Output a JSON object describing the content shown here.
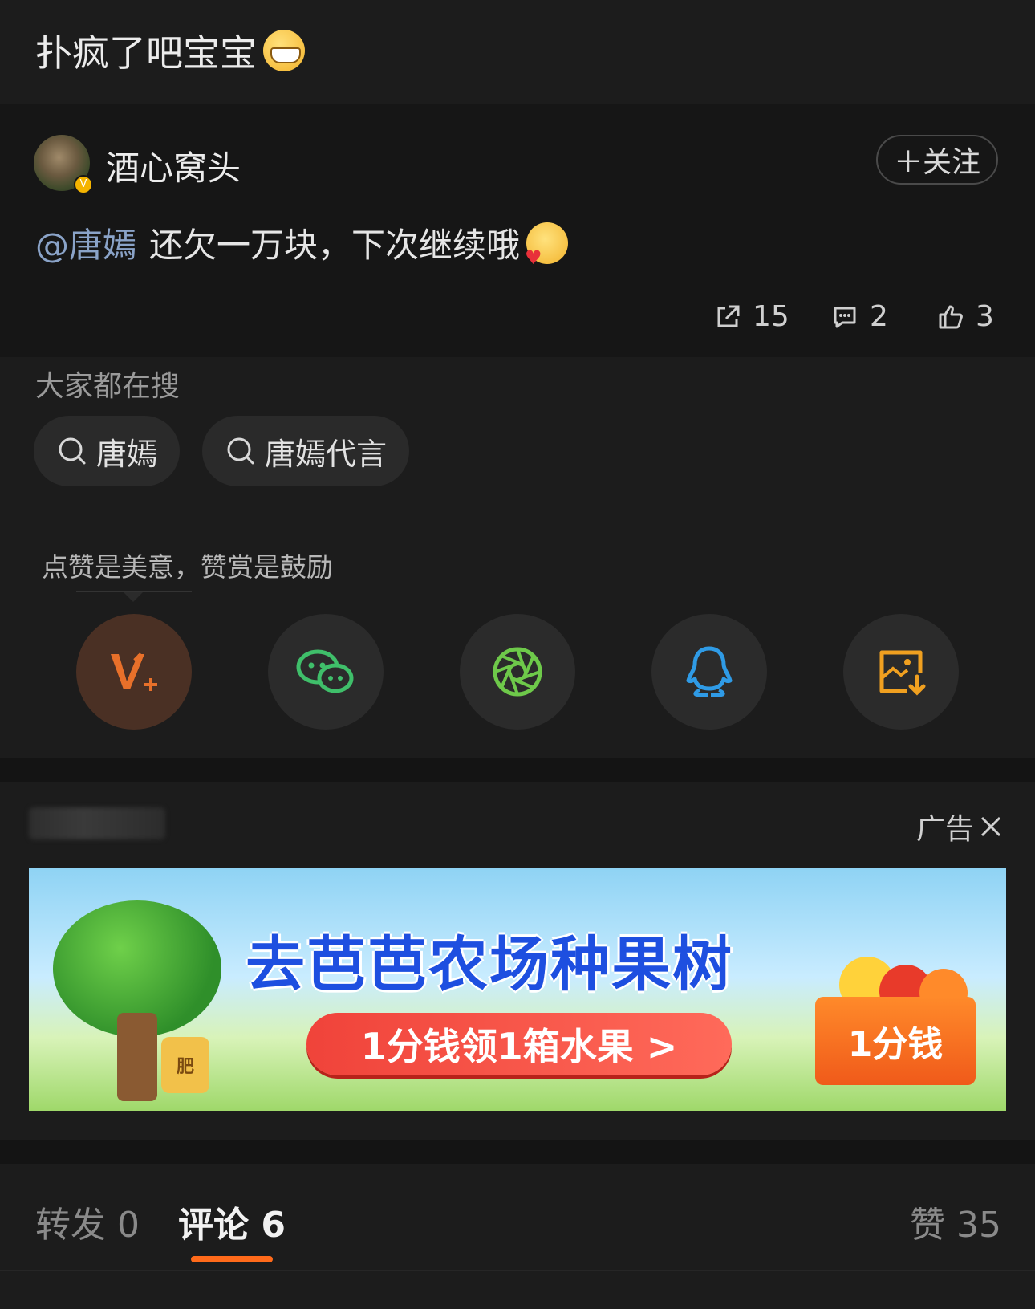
{
  "post": {
    "text": "扑疯了吧宝宝",
    "emoji": "grin-emoji"
  },
  "comment": {
    "username": "酒心窝头",
    "verified_badge": "V",
    "follow_label": "＋关注",
    "mention": "@唐嫣",
    "text": "还欠一万块，下次继续哦",
    "emoji": "kiss-heart-emoji",
    "stats": {
      "reposts": "15",
      "comments": "2",
      "likes": "3"
    }
  },
  "search": {
    "title": "大家都在搜",
    "chips": [
      "唐嫣",
      "唐嫣代言"
    ]
  },
  "reward": {
    "text": "点赞是美意，赞赏是鼓励"
  },
  "share": {
    "items": [
      "v-plus-icon",
      "wechat-icon",
      "moments-icon",
      "qq-icon",
      "save-image-icon"
    ]
  },
  "ad": {
    "label": "广告",
    "title": "去芭芭农场种果树",
    "pill": "1分钱领1箱水果 >",
    "box_label": "1分钱",
    "fert_label": "肥"
  },
  "tabs": {
    "repost": "转发 0",
    "comment": "评论 6",
    "like": "赞 35"
  },
  "colors": {
    "accent": "#ff6a1a",
    "mention": "#8aa3c8",
    "wechat": "#3fbf6a",
    "moments": "#6ec94a",
    "qq": "#2f9be6",
    "save": "#f0a020",
    "vplus": "#e8702a"
  }
}
